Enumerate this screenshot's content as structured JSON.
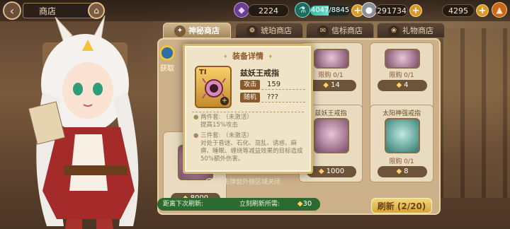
{
  "topbar": {
    "title": "商店",
    "crystal_count": "2224",
    "stamina_text": "4047/8845",
    "stamina_fraction": 0.46,
    "coin_count": "291734",
    "carrot_count": "4295"
  },
  "tabs": [
    {
      "label": "神秘商店",
      "active": true
    },
    {
      "label": "琥珀商店",
      "active": false
    },
    {
      "label": "信标商店",
      "active": false
    },
    {
      "label": "礼物商店",
      "active": false
    }
  ],
  "fetch": {
    "label": "获取"
  },
  "shop": {
    "slots": [
      {
        "name": "",
        "limit": "限购 0/1",
        "price": "14"
      },
      {
        "name": "",
        "limit": "限购 0/1",
        "price": "4"
      },
      {
        "name": "兹妖王戒指",
        "limit": "",
        "price": "1000"
      },
      {
        "name": "太阳神强戒指",
        "limit": "限购 0/1",
        "price": "8"
      }
    ],
    "left_slot_price": "8000",
    "refresh_timer_label": "距离下次刷新:",
    "refresh_cost_label": "立刻刷新所需:",
    "refresh_cost": "30",
    "refresh_button": "刷新 (2/20)"
  },
  "modal": {
    "title": "装备详情",
    "item_tier": "TI",
    "item_name": "兹妖王戒指",
    "stat1_tag": "攻击",
    "stat1_value": "159",
    "stat2_tag": "随机",
    "stat2_value": "???",
    "set2_head": "两件套:   （未激活）",
    "set2_desc": "提高15%攻击",
    "set3_head": "三件套:   （未激活）",
    "set3_desc": "对处于昏迷、石化、混乱、诱惑、麻痹、睡眠、缠绕等减益效果的目标造成50%额外伤害。"
  },
  "hint": "点击弹窗外侧区域关闭",
  "colors": {
    "accent": "#d9b56c",
    "panel": "#cbb08a",
    "refresh": "#2d6a2f"
  }
}
